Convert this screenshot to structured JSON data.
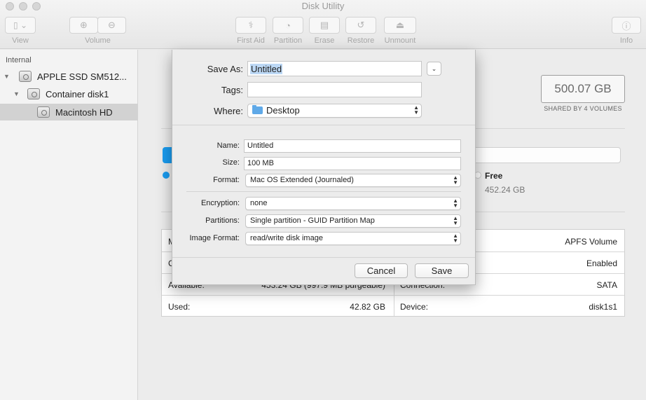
{
  "window": {
    "title": "Disk Utility"
  },
  "toolbar": {
    "view": "View",
    "volume": "Volume",
    "first_aid": "First Aid",
    "partition": "Partition",
    "erase": "Erase",
    "restore": "Restore",
    "unmount": "Unmount",
    "info": "Info"
  },
  "sidebar": {
    "header": "Internal",
    "items": [
      {
        "label": "APPLE SSD SM512...",
        "icon": "internal-disk-icon"
      },
      {
        "label": "Container disk1",
        "icon": "container-disk-icon"
      },
      {
        "label": "Macintosh HD",
        "icon": "volume-disk-icon",
        "selected": true
      }
    ]
  },
  "volume": {
    "capacity": "500.07 GB",
    "capacity_note": "SHARED BY 4 VOLUMES",
    "free_label": "Free",
    "free_value": "452.24 GB",
    "used_color": "#1a9cf0"
  },
  "info": {
    "rows_left": [
      {
        "label": "M",
        "value": ""
      },
      {
        "label": "C",
        "value": ""
      },
      {
        "label": "Available:",
        "value": "453.24 GB (997.9 MB purgeable)"
      },
      {
        "label": "Used:",
        "value": "42.82 GB"
      }
    ],
    "rows_right": [
      {
        "label": "",
        "value": "APFS Volume"
      },
      {
        "label": "",
        "value": "Enabled"
      },
      {
        "label": "Connection:",
        "value": "SATA"
      },
      {
        "label": "Device:",
        "value": "disk1s1"
      }
    ]
  },
  "sheet": {
    "save_as_label": "Save As:",
    "save_as_value": "Untitled",
    "tags_label": "Tags:",
    "tags_value": "",
    "where_label": "Where:",
    "where_value": "Desktop",
    "name_label": "Name:",
    "name_value": "Untitled",
    "size_label": "Size:",
    "size_value": "100 MB",
    "format_label": "Format:",
    "format_value": "Mac OS Extended (Journaled)",
    "encryption_label": "Encryption:",
    "encryption_value": "none",
    "partitions_label": "Partitions:",
    "partitions_value": "Single partition - GUID Partition Map",
    "image_format_label": "Image Format:",
    "image_format_value": "read/write disk image",
    "cancel": "Cancel",
    "save": "Save"
  }
}
